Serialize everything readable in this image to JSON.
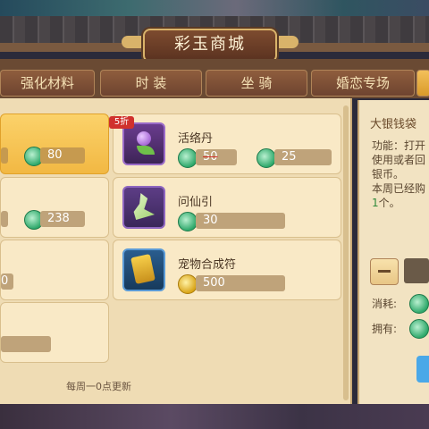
{
  "window": {
    "title": "彩玉商城"
  },
  "tabs": [
    {
      "label": "强化材料"
    },
    {
      "label": "时 装"
    },
    {
      "label": "坐 骑"
    },
    {
      "label": "婚恋专场"
    }
  ],
  "items_left": [
    {
      "price": "80",
      "selected": true
    },
    {
      "price": "238"
    },
    {
      "price": "0"
    },
    {
      "price": ""
    }
  ],
  "items_right": [
    {
      "name": "活络丹",
      "discount_badge": "5折",
      "original_price": "50",
      "price": "25",
      "currency": "jade"
    },
    {
      "name": "问仙引",
      "price": "30",
      "currency": "jade"
    },
    {
      "name": "宠物合成符",
      "price": "500",
      "currency": "gold"
    }
  ],
  "footer": {
    "refresh_note": "每周一0点更新"
  },
  "detail": {
    "title": "大银钱袋",
    "desc_lines": [
      "功能：打开",
      "使用或者回",
      "银币。",
      "本周已经购"
    ],
    "desc_highlight": "1",
    "desc_tail": "个。",
    "cost_label": "消耗:",
    "own_label": "拥有:"
  },
  "colors": {
    "jade_currency": "#2ea86a",
    "gold_currency": "#d9a417",
    "discount": "#d0312d"
  }
}
